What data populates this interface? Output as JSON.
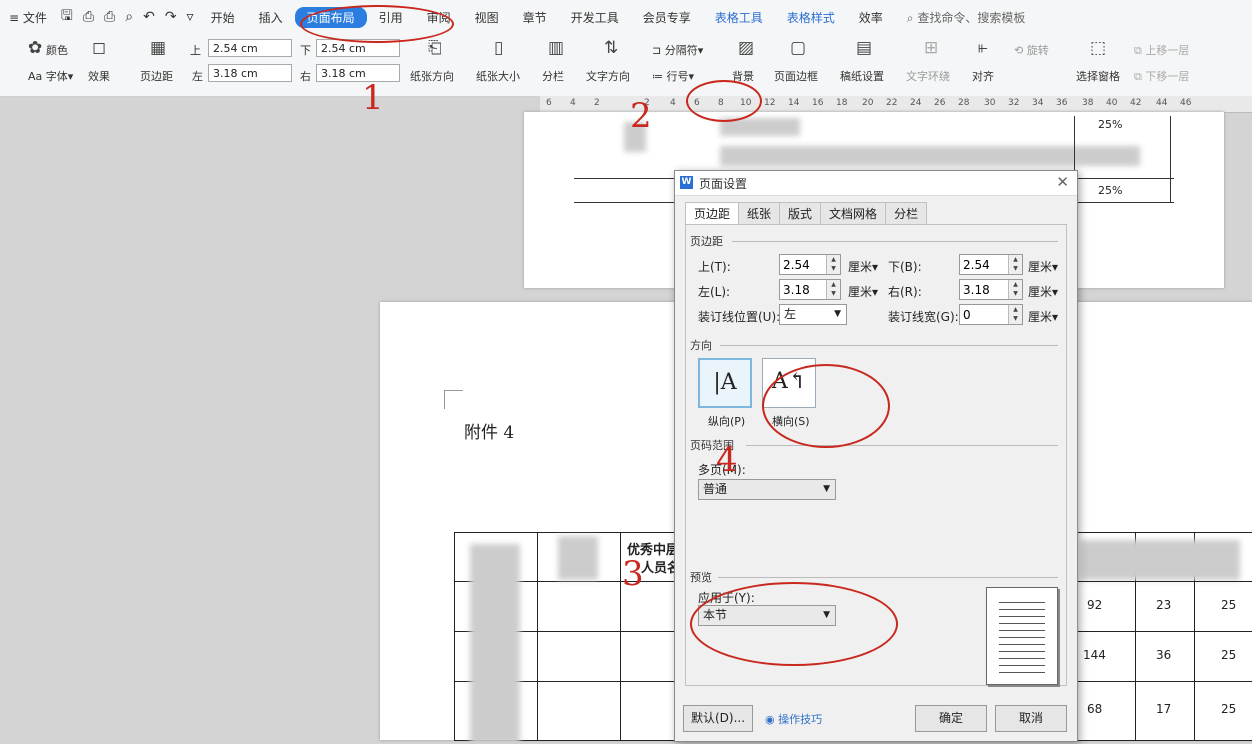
{
  "menubar": {
    "file": "文件",
    "tabs": [
      "开始",
      "插入",
      "页面布局",
      "引用",
      "审阅",
      "视图",
      "章节",
      "开发工具",
      "会员专享",
      "表格工具",
      "表格样式",
      "效率"
    ],
    "active_tab": "页面布局",
    "search": "查找命令、搜索模板"
  },
  "toolbar": {
    "theme": "颜色",
    "font": "字体",
    "effect": "效果",
    "margins": "页边距",
    "top_label": "上",
    "top_value": "2.54 cm",
    "bottom_label": "下",
    "bottom_value": "2.54 cm",
    "left_label": "左",
    "left_value": "3.18 cm",
    "right_label": "右",
    "right_value": "3.18 cm",
    "orientation": "纸张方向",
    "size": "纸张大小",
    "columns": "分栏",
    "text_dir": "文字方向",
    "breaks": "分隔符",
    "line_num": "行号",
    "background": "背景",
    "page_border": "页面边框",
    "paper_setup": "稿纸设置",
    "wrap": "文字环绕",
    "align": "对齐",
    "rotate": "旋转",
    "select_pane": "选择窗格",
    "up_layer": "上移一层",
    "down_layer": "下移一层"
  },
  "ruler": [
    "6",
    "4",
    "2",
    "2",
    "4",
    "6",
    "8",
    "10",
    "12",
    "14",
    "16",
    "18",
    "20",
    "22",
    "24",
    "26",
    "28",
    "30",
    "32",
    "34",
    "36",
    "38",
    "40",
    "42",
    "44",
    "46"
  ],
  "document": {
    "attachment_title": "附件 4",
    "p1_cells": [
      "25%",
      "25%"
    ],
    "p2_header": [
      "优秀中层",
      "人员名"
    ],
    "p2_values": [
      [
        "92",
        "23",
        "25"
      ],
      [
        "144",
        "36",
        "25"
      ],
      [
        "68",
        "17",
        "25"
      ]
    ]
  },
  "dialog": {
    "title": "页面设置",
    "tabs": [
      "页边距",
      "纸张",
      "版式",
      "文档网格",
      "分栏"
    ],
    "active_tab": "页边距",
    "margins_section": "页边距",
    "top_label": "上(T):",
    "top": "2.54",
    "bottom_label": "下(B):",
    "bottom": "2.54",
    "left_label": "左(L):",
    "left": "3.18",
    "right_label": "右(R):",
    "right": "3.18",
    "gutter_pos_label": "装订线位置(U):",
    "gutter_pos": "左",
    "gutter_width_label": "装订线宽(G):",
    "gutter_width": "0",
    "unit": "厘米",
    "orientation_section": "方向",
    "portrait": "纵向(P)",
    "landscape": "横向(S)",
    "pages_section": "页码范围",
    "multiple_pages_label": "多页(M):",
    "multiple_pages": "普通",
    "preview_section": "预览",
    "apply_to_label": "应用于(Y):",
    "apply_to": "本节",
    "default_btn": "默认(D)...",
    "tips": "操作技巧",
    "ok": "确定",
    "cancel": "取消"
  },
  "annotations": [
    "1",
    "2",
    "4",
    "3"
  ]
}
